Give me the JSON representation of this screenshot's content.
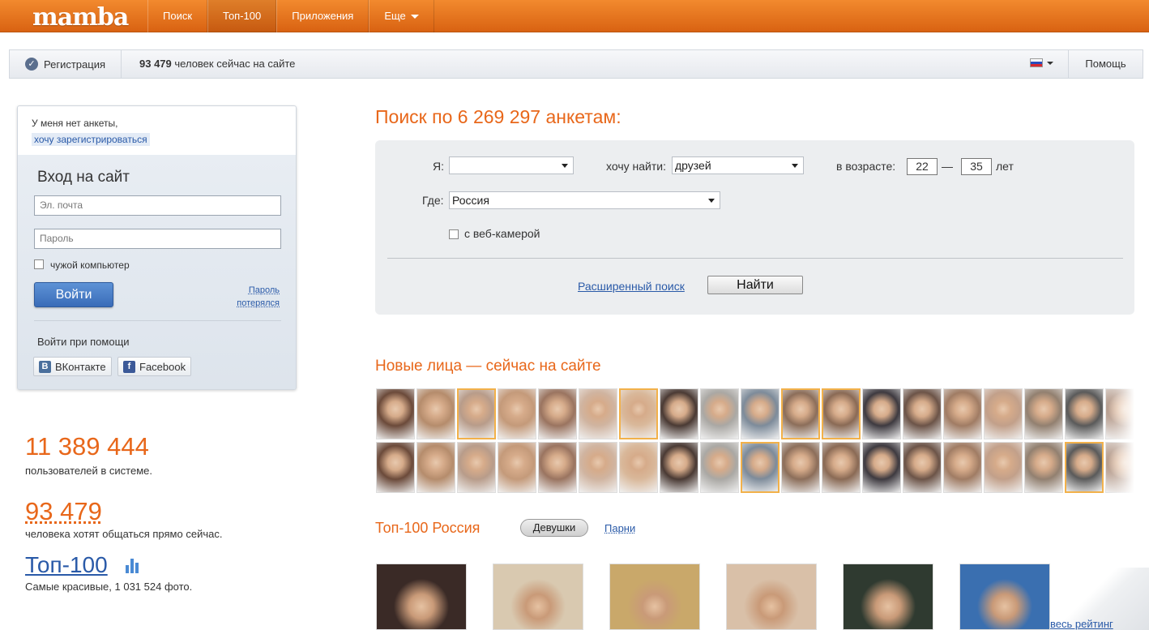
{
  "header": {
    "logo": "mamba",
    "nav": [
      {
        "label": "Поиск"
      },
      {
        "label": "Топ-100"
      },
      {
        "label": "Приложения"
      },
      {
        "label": "Еще"
      }
    ]
  },
  "subbar": {
    "register_label": "Регистрация",
    "online_count": "93 479",
    "online_text": "человек сейчас на сайте",
    "help_label": "Помощь"
  },
  "login": {
    "no_profile": "У меня нет анкеты,",
    "register_link": "хочу зарегистрироваться",
    "title": "Вход на сайт",
    "email_placeholder": "Эл. почта",
    "password_placeholder": "Пароль",
    "foreign_computer": "чужой компьютер",
    "login_button": "Войти",
    "lost_line1": "Пароль",
    "lost_line2": "потерялся",
    "social_label": "Войти при помощи",
    "vk_label": "ВКонтакте",
    "fb_label": "Facebook"
  },
  "stats": {
    "users_num": "11 389 444",
    "users_text": "пользователей в системе.",
    "online_num": "93 479",
    "online_text": "человека хотят общаться прямо сейчас.",
    "top_link": "Топ-100",
    "top_text": "Самые красивые, 1 031 524 фото."
  },
  "search": {
    "title": "Поиск по 6 269 297 анкетам:",
    "i_label": "Я:",
    "i_value": "",
    "find_label": "хочу найти:",
    "find_value": "друзей",
    "age_label": "в возрасте:",
    "age_from": "22",
    "age_dash": "—",
    "age_to": "35",
    "age_unit": "лет",
    "where_label": "Где:",
    "where_value": "Россия",
    "webcam_label": "с веб-камерой",
    "advanced_link": "Расширенный поиск",
    "find_button": "Найти"
  },
  "new_faces": {
    "title": "Новые лица — сейчас на сайте"
  },
  "top100": {
    "title": "Топ-100 Россия",
    "tab_girls": "Девушки",
    "tab_boys": "Парни",
    "all_rating": "весь рейтинг"
  },
  "colors": {
    "accent": "#e8671a",
    "link": "#2a5aa8",
    "header": "#e8761e"
  }
}
